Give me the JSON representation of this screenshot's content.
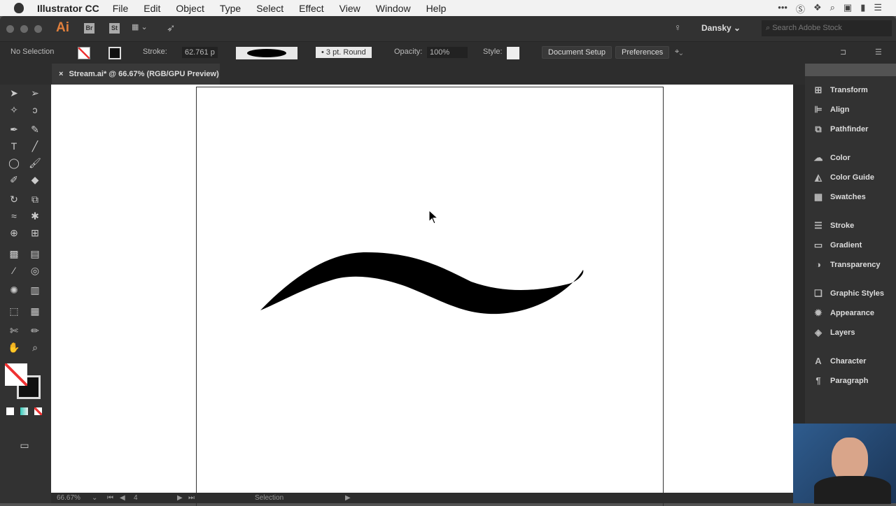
{
  "menubar": {
    "app": "Illustrator CC",
    "items": [
      "File",
      "Edit",
      "Object",
      "Type",
      "Select",
      "Effect",
      "View",
      "Window",
      "Help"
    ]
  },
  "appbar": {
    "logo": "Ai",
    "bridge": "Br",
    "stock": "St",
    "workspace": "Dansky",
    "search_placeholder": "Search Adobe Stock"
  },
  "control": {
    "selection": "No Selection",
    "stroke_label": "Stroke:",
    "stroke_value": "62.761 p",
    "brush": "3 pt. Round",
    "opacity_label": "Opacity:",
    "opacity_value": "100%",
    "style_label": "Style:",
    "doc_setup": "Document Setup",
    "preferences": "Preferences"
  },
  "tab": {
    "title": "Stream.ai* @ 66.67% (RGB/GPU Preview)"
  },
  "panels": [
    "Transform",
    "Align",
    "Pathfinder",
    "Color",
    "Color Guide",
    "Swatches",
    "Stroke",
    "Gradient",
    "Transparency",
    "Graphic Styles",
    "Appearance",
    "Layers",
    "Character",
    "Paragraph"
  ],
  "status": {
    "zoom": "66.67%",
    "artboard": "4",
    "tool": "Selection"
  }
}
